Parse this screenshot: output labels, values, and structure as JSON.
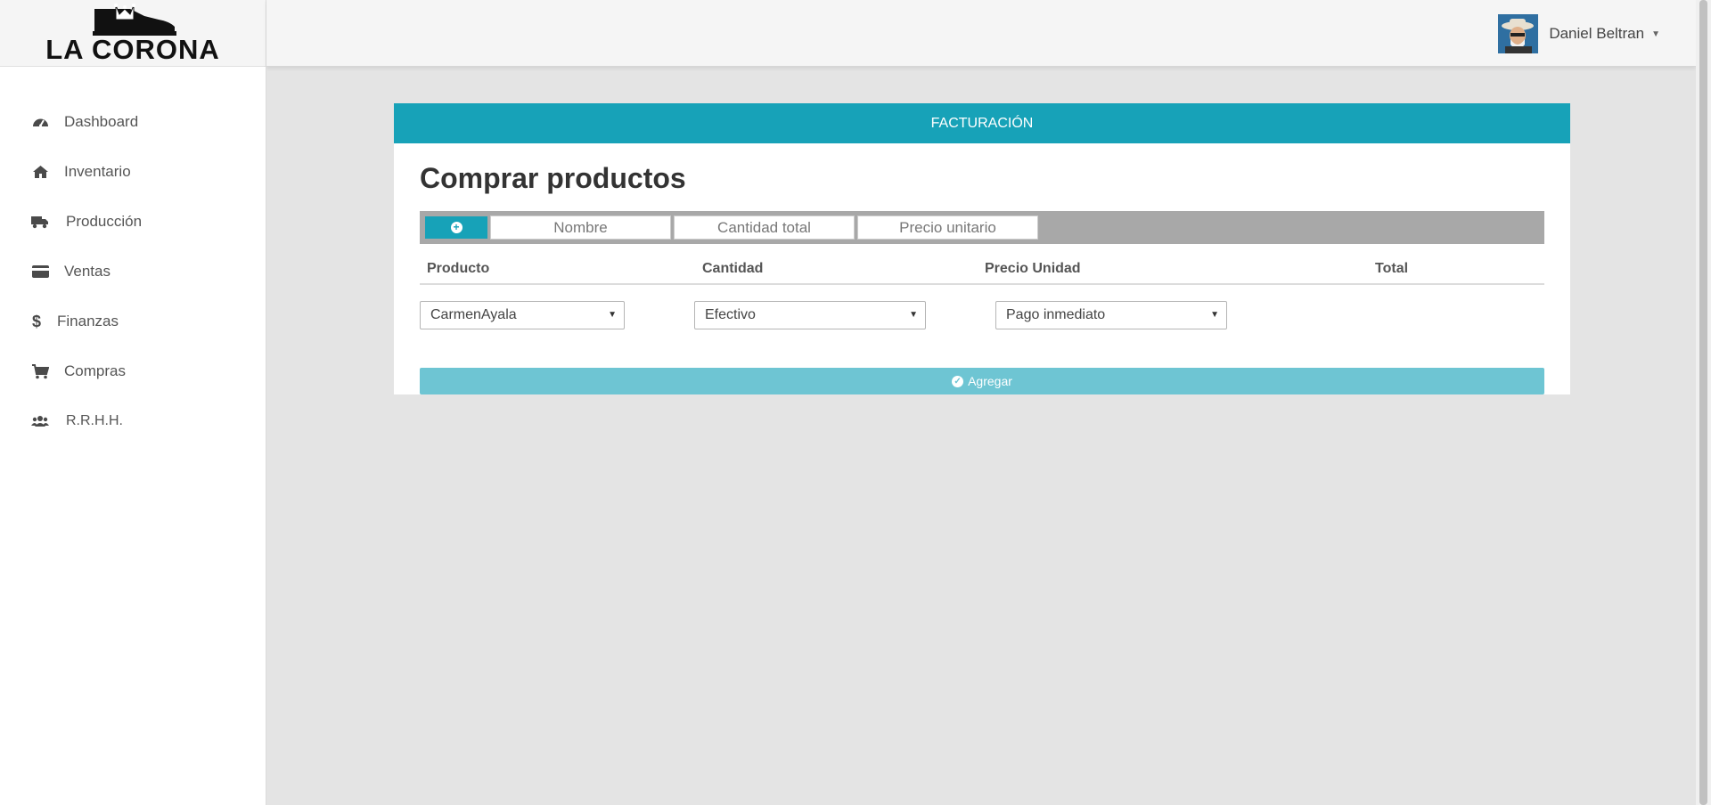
{
  "brand": {
    "name": "LA CORONA"
  },
  "user": {
    "name": "Daniel Beltran",
    "caret": "⌄"
  },
  "sidebar": {
    "items": [
      {
        "label": "Dashboard",
        "icon": "tachometer-icon"
      },
      {
        "label": "Inventario",
        "icon": "home-icon"
      },
      {
        "label": "Producción",
        "icon": "truck-icon"
      },
      {
        "label": "Ventas",
        "icon": "credit-card-icon"
      },
      {
        "label": "Finanzas",
        "icon": "dollar-icon"
      },
      {
        "label": "Compras",
        "icon": "shopping-cart-icon"
      },
      {
        "label": "R.R.H.H.",
        "icon": "users-icon"
      }
    ]
  },
  "panel": {
    "header": "FACTURACIÓN",
    "title": "Comprar productos",
    "toolbar": {
      "name_placeholder": "Nombre",
      "quantity_placeholder": "Cantidad total",
      "price_placeholder": "Precio unitario"
    },
    "table": {
      "columns": [
        "Producto",
        "Cantidad",
        "Precio Unidad",
        "Total"
      ]
    },
    "selects": {
      "supplier": "CarmenAyala",
      "payment_method": "Efectivo",
      "payment_term": "Pago inmediato"
    },
    "submit_label": "Agregar"
  },
  "colors": {
    "accent": "#17a2b8",
    "accent_light": "#6ec5d3",
    "background": "#e4e4e4"
  }
}
